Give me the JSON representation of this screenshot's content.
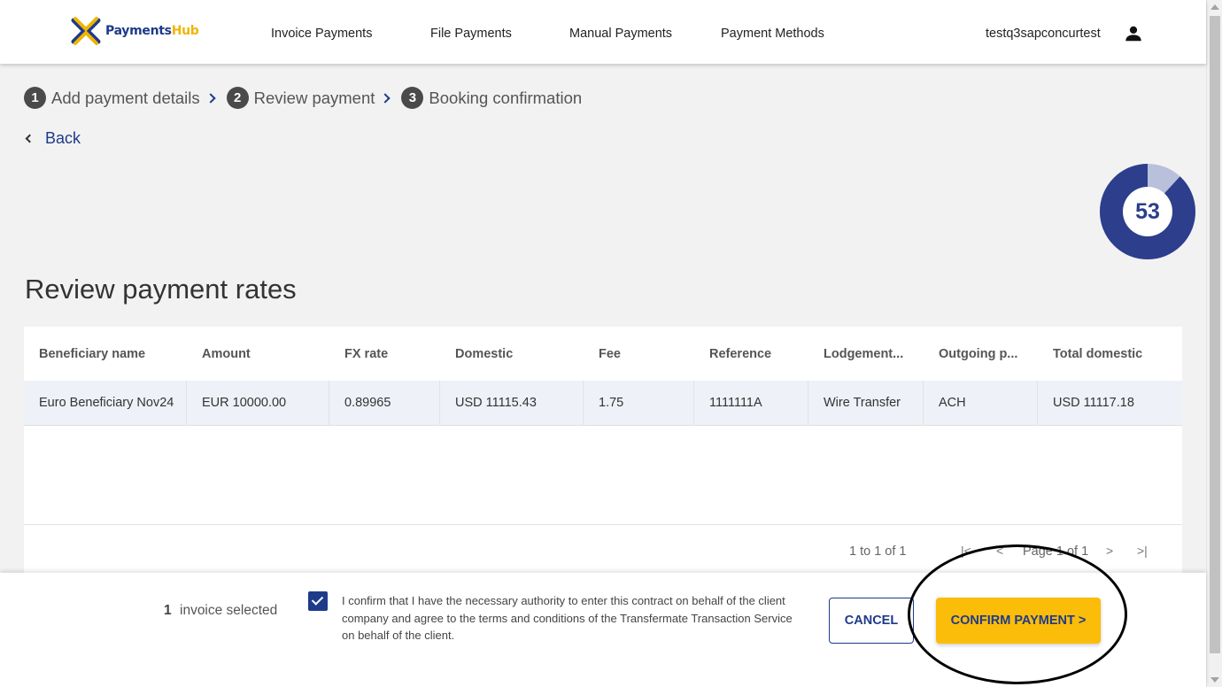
{
  "header": {
    "logo_brand": "Payments",
    "logo_brand_accent": "Hub",
    "nav": [
      "Invoice Payments",
      "File Payments",
      "Manual Payments",
      "Payment Methods"
    ],
    "username": "testq3sapconcurtest"
  },
  "stepper": {
    "steps": [
      {
        "num": "1",
        "label": "Add payment details"
      },
      {
        "num": "2",
        "label": "Review payment"
      },
      {
        "num": "3",
        "label": "Booking confirmation"
      }
    ]
  },
  "back_label": "Back",
  "timer": {
    "value": "53",
    "fraction_remaining": 0.88
  },
  "page_title": "Review payment rates",
  "grid": {
    "columns": [
      "Beneficiary name",
      "Amount",
      "FX rate",
      "Domestic",
      "Fee",
      "Reference",
      "Lodgement...",
      "Outgoing p...",
      "Total domestic"
    ],
    "rows": [
      [
        "Euro Beneficiary Nov24",
        "EUR 10000.00",
        "0.89965",
        "USD 11115.43",
        "1.75",
        "1111111A",
        "Wire Transfer",
        "ACH",
        "USD 11117.18"
      ]
    ],
    "pagination": {
      "range": "1 to 1 of 1",
      "page": "Page 1 of 1"
    }
  },
  "footer": {
    "invoice_count": "1",
    "invoice_label": "invoice selected",
    "confirm_text": "I confirm that I have the necessary authority to enter this contract on behalf of the client company and agree to the terms and conditions of the Transfermate Transaction Service on behalf of the client.",
    "cancel_label": "CANCEL",
    "confirm_label": "CONFIRM PAYMENT >"
  },
  "colors": {
    "brand": "#1e3a8a",
    "accent": "#fbbd09"
  }
}
